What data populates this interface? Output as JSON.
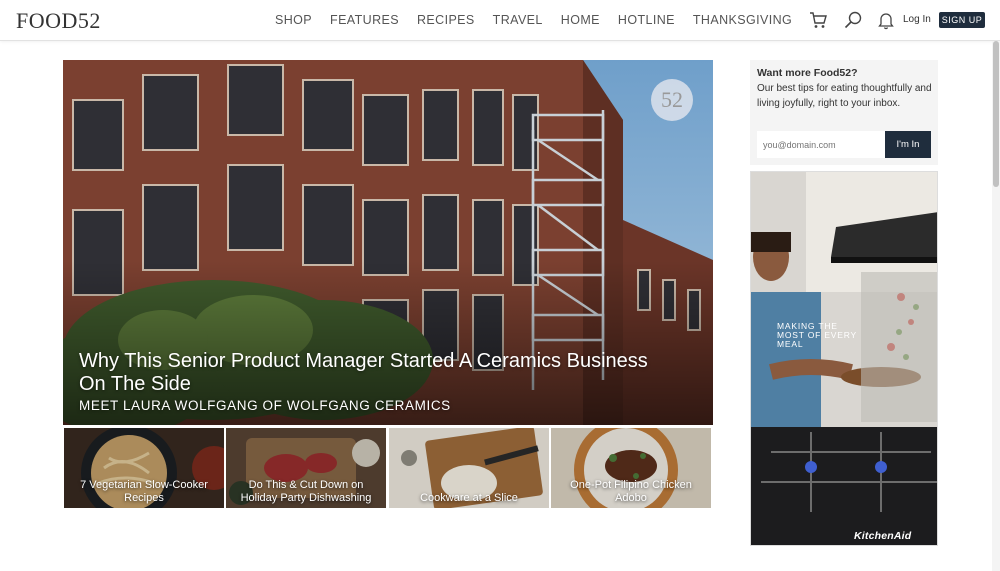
{
  "header": {
    "logo": "FOOD52",
    "nav": [
      "SHOP",
      "FEATURES",
      "RECIPES",
      "TRAVEL",
      "HOME",
      "HOTLINE",
      "THANKSGIVING"
    ],
    "icons": [
      "cart-icon",
      "search-icon",
      "bell-icon"
    ],
    "login": "Log In",
    "signup": "SIGN UP"
  },
  "hero": {
    "title": "Why This Senior Product Manager Started A Ceramics Business On The Side",
    "subtitle": "MEET LAURA WOLFGANG OF WOLFGANG CERAMICS",
    "badge": "52"
  },
  "cards": [
    {
      "caption": "7 Vegetarian Slow-Cooker Recipes"
    },
    {
      "caption": "Do This & Cut Down on Holiday Party Dishwashing"
    },
    {
      "caption": "Cookware at a Slice"
    },
    {
      "caption": "One-Pot Filipino Chicken Adobo"
    }
  ],
  "newsletter": {
    "heading": "Want more Food52?",
    "text": "Our best tips for eating thoughtfully and living joyfully, right to your inbox.",
    "placeholder": "you@domain.com",
    "button": "I'm In"
  },
  "ad": {
    "copy": "MAKING THE MOST OF EVERY MEAL",
    "brand": "KitchenAid"
  },
  "colors": {
    "accent": "#1f2d3d",
    "brick": "#7a3f2e",
    "sky": "#7fa9cc"
  }
}
